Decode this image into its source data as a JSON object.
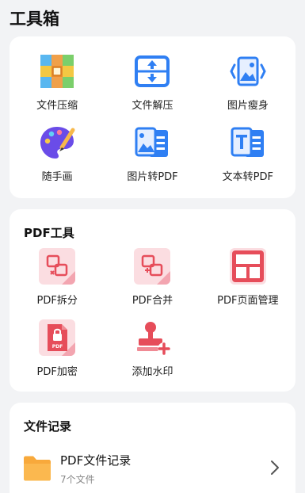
{
  "header": {
    "title": "工具箱"
  },
  "toolbox": {
    "items": [
      {
        "label": "文件压缩",
        "icon": "archive-icon"
      },
      {
        "label": "文件解压",
        "icon": "unzip-arrows-icon"
      },
      {
        "label": "图片瘦身",
        "icon": "image-compress-icon"
      },
      {
        "label": "随手画",
        "icon": "paint-palette-icon"
      },
      {
        "label": "图片转PDF",
        "icon": "image-to-doc-icon"
      },
      {
        "label": "文本转PDF",
        "icon": "text-to-doc-icon"
      }
    ]
  },
  "pdf_tools": {
    "title": "PDF工具",
    "items": [
      {
        "label": "PDF拆分",
        "icon": "pdf-split-icon"
      },
      {
        "label": "PDF合并",
        "icon": "pdf-merge-icon"
      },
      {
        "label": "PDF页面管理",
        "icon": "pdf-page-layout-icon"
      },
      {
        "label": "PDF加密",
        "icon": "pdf-lock-icon"
      },
      {
        "label": "添加水印",
        "icon": "stamp-add-icon"
      }
    ]
  },
  "records": {
    "title": "文件记录",
    "items": [
      {
        "title": "PDF文件记录",
        "subtitle": "7个文件",
        "icon": "folder-icon"
      }
    ]
  },
  "colors": {
    "blue": "#2f7ff3",
    "pdf_red": "#e64d5a",
    "pdf_pink": "#fbdde1",
    "folder": "#f8a93b",
    "purple": "#6a4ce8"
  }
}
